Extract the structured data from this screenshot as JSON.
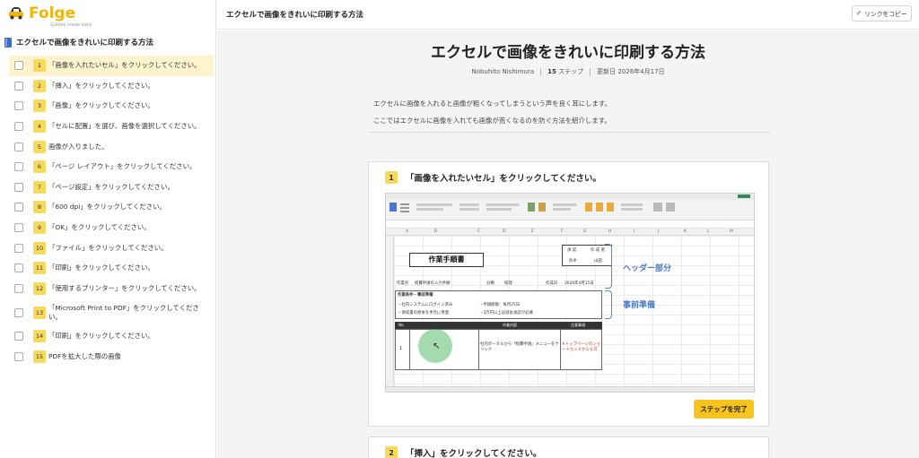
{
  "app": {
    "brand": "Folge",
    "brand_sub": "Guides made easy",
    "accent": "#f2b40b"
  },
  "sidebar": {
    "doc_title": "エクセルで画像をきれいに印刷する方法",
    "steps": [
      {
        "num": "1",
        "text": "「画像を入れたいセル」をクリックしてください。",
        "active": true
      },
      {
        "num": "2",
        "text": "「挿入」をクリックしてください。"
      },
      {
        "num": "3",
        "text": "「画像」をクリックしてください。"
      },
      {
        "num": "4",
        "text": "「セルに配置」を選び、画像を選択してください。"
      },
      {
        "num": "5",
        "text": "画像が入りました。"
      },
      {
        "num": "6",
        "text": "「ページ レイアウト」をクリックしてください。"
      },
      {
        "num": "7",
        "text": "「ページ設定」をクリックしてください。"
      },
      {
        "num": "8",
        "text": "「600 dpi」をクリックしてください。"
      },
      {
        "num": "9",
        "text": "「OK」をクリックしてください。"
      },
      {
        "num": "10",
        "text": "「ファイル」をクリックしてください。"
      },
      {
        "num": "11",
        "text": "「印刷」をクリックしてください。"
      },
      {
        "num": "12",
        "text": "「使用するプリンター」をクリックしてください。"
      },
      {
        "num": "13",
        "text": "「Microsoft Print to PDF」をクリックしてください。"
      },
      {
        "num": "14",
        "text": "「印刷」をクリックしてください。"
      },
      {
        "num": "15",
        "text": "PDFを拡大した際の画像"
      }
    ]
  },
  "header": {
    "title": "エクセルで画像をきれいに印刷する方法",
    "copy_link_label": "リンクをコピー",
    "copy_link_icon": "link-icon"
  },
  "article": {
    "title": "エクセルで画像をきれいに印刷する方法",
    "author": "Nobuhito Nishimura",
    "step_count": "15",
    "step_unit": "ステップ",
    "updated": "更新日 2026年4月17日",
    "intro": [
      "エクセルに画像を入れると画像が粗くなってしまうという声を良く耳にします。",
      "ここではエクセルに画像を入れても画像が荒くなるのを防ぐ方法を紹介します。"
    ]
  },
  "step_cards": [
    {
      "num": "1",
      "title": "「画像を入れたいセル」をクリックしてください。",
      "complete_label": "ステップを完了",
      "screenshot": {
        "sheet_title": "作業手順書",
        "annotation_header": "ヘッダー部分",
        "annotation_prep": "事前準備",
        "cells": {
          "approval": "承 認",
          "author_label": "作 成 者",
          "approver": "鈴木",
          "creator": "山田",
          "work_name_label": "作業名",
          "work_name": "経費申請の入力手順",
          "category_label": "分類",
          "category": "経理",
          "created_label": "作成日",
          "created": "2026年4月15日",
          "prep_title": "作業条件・事前準備",
          "prep_1": "・社内システムにログイン済み",
          "prep_2": "・領収書の原本を手元に用意",
          "deadline": "・申請期限：毎月25日",
          "approval_note": "・3万円以上は部長承認が必要",
          "col_no": "No.",
          "col_content": "作業内容",
          "col_notes": "注意事項",
          "row_no": "1",
          "row_content": "社内ポータルから「経費申請」メニューをクリック",
          "row_note": "※トップページのショートカットからも可"
        }
      }
    },
    {
      "num": "2",
      "title": "「挿入」をクリックしてください。"
    }
  ]
}
